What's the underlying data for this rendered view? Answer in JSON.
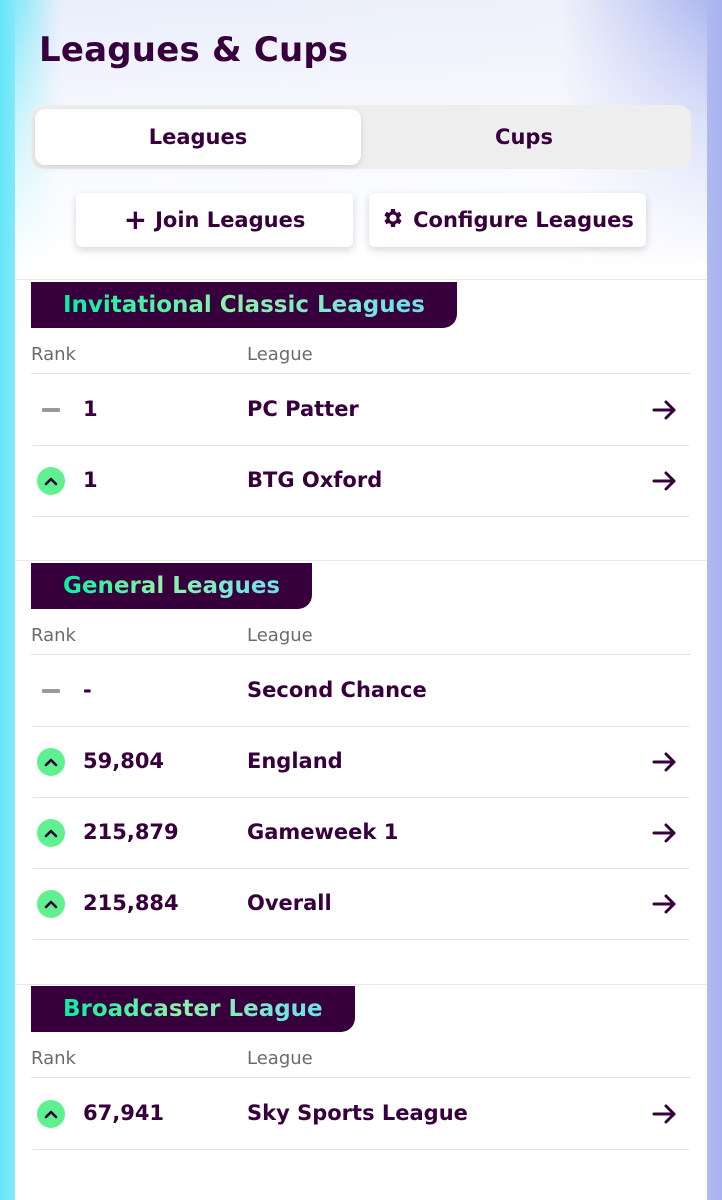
{
  "header": {
    "title": "Leagues & Cups"
  },
  "tabs": [
    {
      "label": "Leagues",
      "active": true
    },
    {
      "label": "Cups",
      "active": false
    }
  ],
  "actions": {
    "join_label": "Join Leagues",
    "configure_label": "Configure Leagues"
  },
  "columns": {
    "rank": "Rank",
    "league": "League"
  },
  "sections": [
    {
      "title": "Invitational Classic Leagues",
      "rows": [
        {
          "movement": "same",
          "rank": "1",
          "league": "PC Patter",
          "has_arrow": true
        },
        {
          "movement": "up",
          "rank": "1",
          "league": "BTG Oxford",
          "has_arrow": true
        }
      ]
    },
    {
      "title": "General Leagues",
      "rows": [
        {
          "movement": "same",
          "rank": "-",
          "league": "Second Chance",
          "has_arrow": false
        },
        {
          "movement": "up",
          "rank": "59,804",
          "league": "England",
          "has_arrow": true
        },
        {
          "movement": "up",
          "rank": "215,879",
          "league": "Gameweek 1",
          "has_arrow": true
        },
        {
          "movement": "up",
          "rank": "215,884",
          "league": "Overall",
          "has_arrow": true
        }
      ]
    },
    {
      "title": "Broadcaster League",
      "rows": [
        {
          "movement": "up",
          "rank": "67,941",
          "league": "Sky Sports League",
          "has_arrow": true
        }
      ]
    }
  ],
  "colors": {
    "primary": "#37003c",
    "up": "#5ff08f",
    "accent_green": "#05f0a0",
    "accent_cyan": "#6ee0ee"
  }
}
